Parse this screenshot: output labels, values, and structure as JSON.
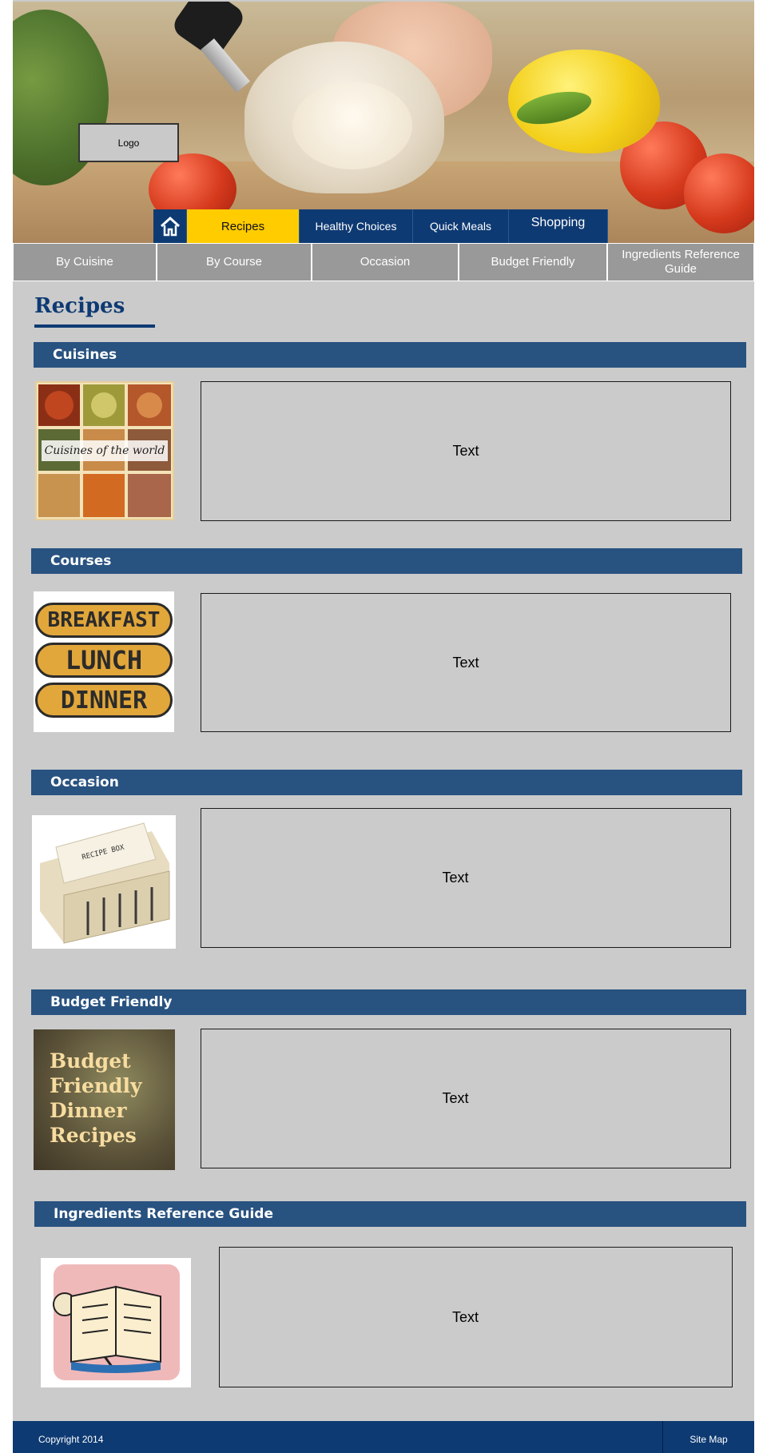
{
  "header": {
    "logo_text": "Logo"
  },
  "main_nav": {
    "home_icon": "home-icon",
    "items": [
      {
        "label": "Recipes",
        "active": true
      },
      {
        "label": "Healthy Choices",
        "active": false
      },
      {
        "label": "Quick Meals",
        "active": false
      },
      {
        "label": "Shopping",
        "active": false
      }
    ]
  },
  "sub_nav": {
    "items": [
      {
        "label": "By Cuisine"
      },
      {
        "label": "By Course"
      },
      {
        "label": "Occasion"
      },
      {
        "label": "Budget Friendly"
      },
      {
        "label": "Ingredients Reference Guide"
      }
    ]
  },
  "page_title": "Recipes",
  "sections": [
    {
      "title": "Cuisines",
      "image_caption": "Cuisines of the world",
      "text": "Text"
    },
    {
      "title": "Courses",
      "image_lines": [
        "BREAKFAST",
        "LUNCH",
        "DINNER"
      ],
      "text": "Text"
    },
    {
      "title": "Occasion",
      "image_label": "RECIPE BOX",
      "text": "Text"
    },
    {
      "title": "Budget Friendly",
      "image_lines": [
        "Budget",
        "Friendly",
        "Dinner",
        "Recipes"
      ],
      "text": "Text"
    },
    {
      "title": "Ingredients Reference Guide",
      "text": "Text"
    }
  ],
  "footer": {
    "copyright": "Copyright 2014",
    "site_map": "Site Map"
  },
  "colors": {
    "navy": "#0e3a73",
    "section_bar": "#285280",
    "active_tab": "#ffcc00",
    "subnav_gray": "#999999",
    "page_bg": "#cbcbcb"
  }
}
